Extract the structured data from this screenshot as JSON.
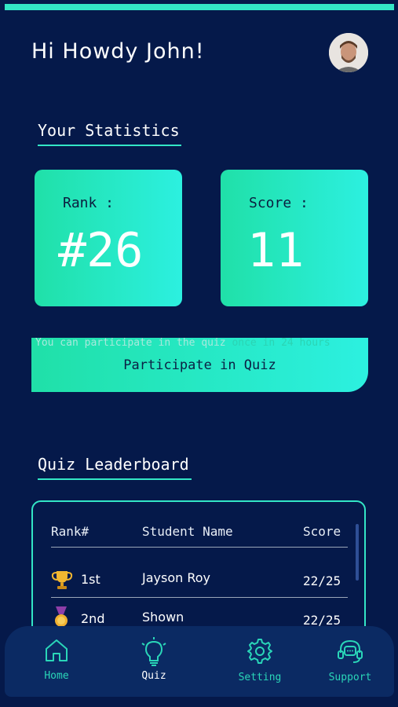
{
  "header": {
    "greeting": "Hi Howdy John!",
    "avatar_icon": "user-avatar"
  },
  "statistics": {
    "title": "Your Statistics",
    "rank_label": "Rank :",
    "rank_value": "#26",
    "score_label": "Score :",
    "score_value": "11"
  },
  "quiz": {
    "notice_prefix": "You can participate in the quiz ",
    "notice_highlight": "once in 24 hours",
    "participate_label": "Participate in Quiz"
  },
  "leaderboard": {
    "title": "Quiz Leaderboard",
    "columns": [
      "Rank#",
      "Student Name",
      "Score"
    ],
    "rows": [
      {
        "rank": "1st",
        "name": "Jayson Roy",
        "score": "22/25",
        "icon": "trophy-icon"
      },
      {
        "rank": "2nd",
        "name": "Shown",
        "score": "22/25",
        "icon": "medal-icon"
      }
    ]
  },
  "nav": {
    "items": [
      {
        "label": "Home",
        "icon": "home-icon"
      },
      {
        "label": "Quiz",
        "icon": "lightbulb-icon"
      },
      {
        "label": "Setting",
        "icon": "gear-icon"
      },
      {
        "label": "Support",
        "icon": "headset-icon"
      }
    ],
    "active_index": 1
  },
  "colors": {
    "background": "#05194a",
    "accent": "#33e6c6",
    "navbar": "#0b2a63"
  }
}
